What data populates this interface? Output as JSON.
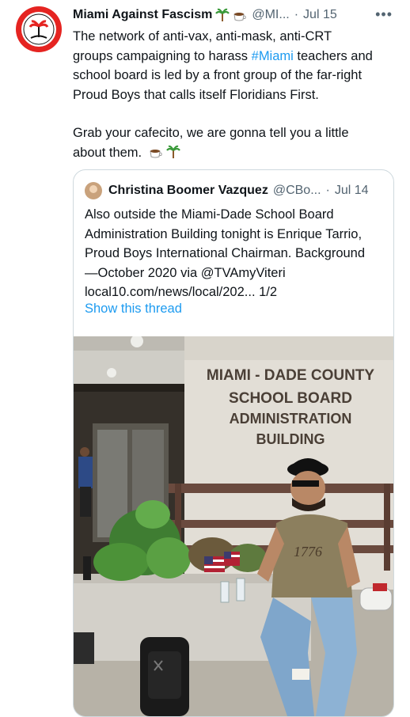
{
  "tweet": {
    "author": {
      "name": "Miami Against Fascism",
      "emojis": [
        "palm-tree-icon",
        "coffee-cup-icon"
      ],
      "handle": "@MI...",
      "time": "Jul 15"
    },
    "more_label": "•••",
    "text_line1": "The network of anti-vax, anti-mask, anti-CRT",
    "text_line2_pre": "groups campaigning to harass ",
    "hashtag": "#Miami",
    "text_line2_post": " teachers and",
    "text_line3": "school board is led by a front group of the far-right",
    "text_line4": "Proud Boys that calls itself Floridians First.",
    "para2_line1": "Grab your cafecito, we are gonna tell you a little",
    "para2_line2": "about them."
  },
  "quoted": {
    "name": "Christina Boomer Vazquez",
    "handle": "@CBo...",
    "time": "Jul 14",
    "lines": [
      "Also outside the Miami-Dade School Board",
      "Administration Building tonight is Enrique Tarrio,",
      "Proud Boys International Chairman. Background",
      "—October 2020 via @TVAmyViteri",
      "local10.com/news/local/202... 1/2"
    ],
    "show_thread": "Show this thread",
    "photo_sign": [
      "MIAMI - DADE COUNTY",
      "SCHOOL BOARD",
      "ADMINISTRATION",
      "BUILDING"
    ],
    "shirt_text": "1776"
  },
  "colors": {
    "link": "#1d9bf0",
    "secondary": "#536471",
    "avatar_red": "#e52421"
  }
}
